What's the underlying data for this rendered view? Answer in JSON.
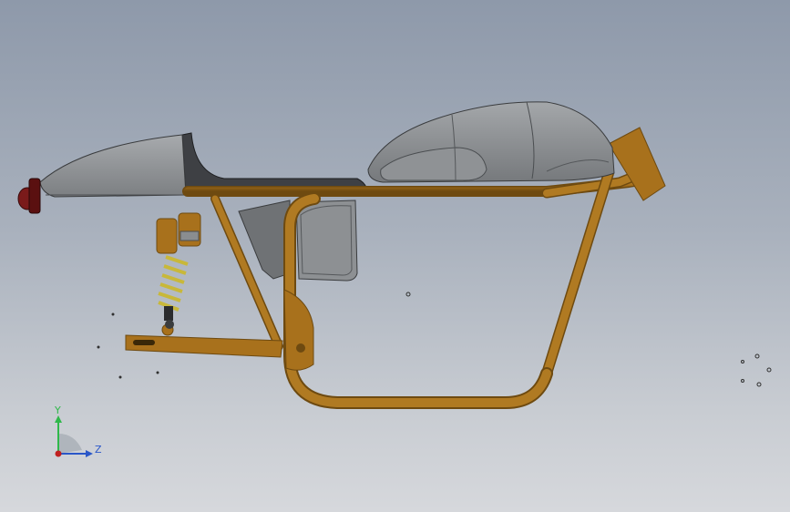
{
  "viewport": {
    "background_top": "#8e99aa",
    "background_bottom": "#d6d8dc"
  },
  "model": {
    "frame_color": "#a8711c",
    "frame_dark": "#6e4a10",
    "bodywork_color": "#8a8d90",
    "seat_color": "#3e4044",
    "spring_color": "#c8b83a",
    "taillight_color": "#7a1a1a"
  },
  "triad": {
    "y_label": "Y",
    "z_label": "Z",
    "y_color": "#2fb84a",
    "z_color": "#2a57c8",
    "origin_color": "#c02020"
  }
}
